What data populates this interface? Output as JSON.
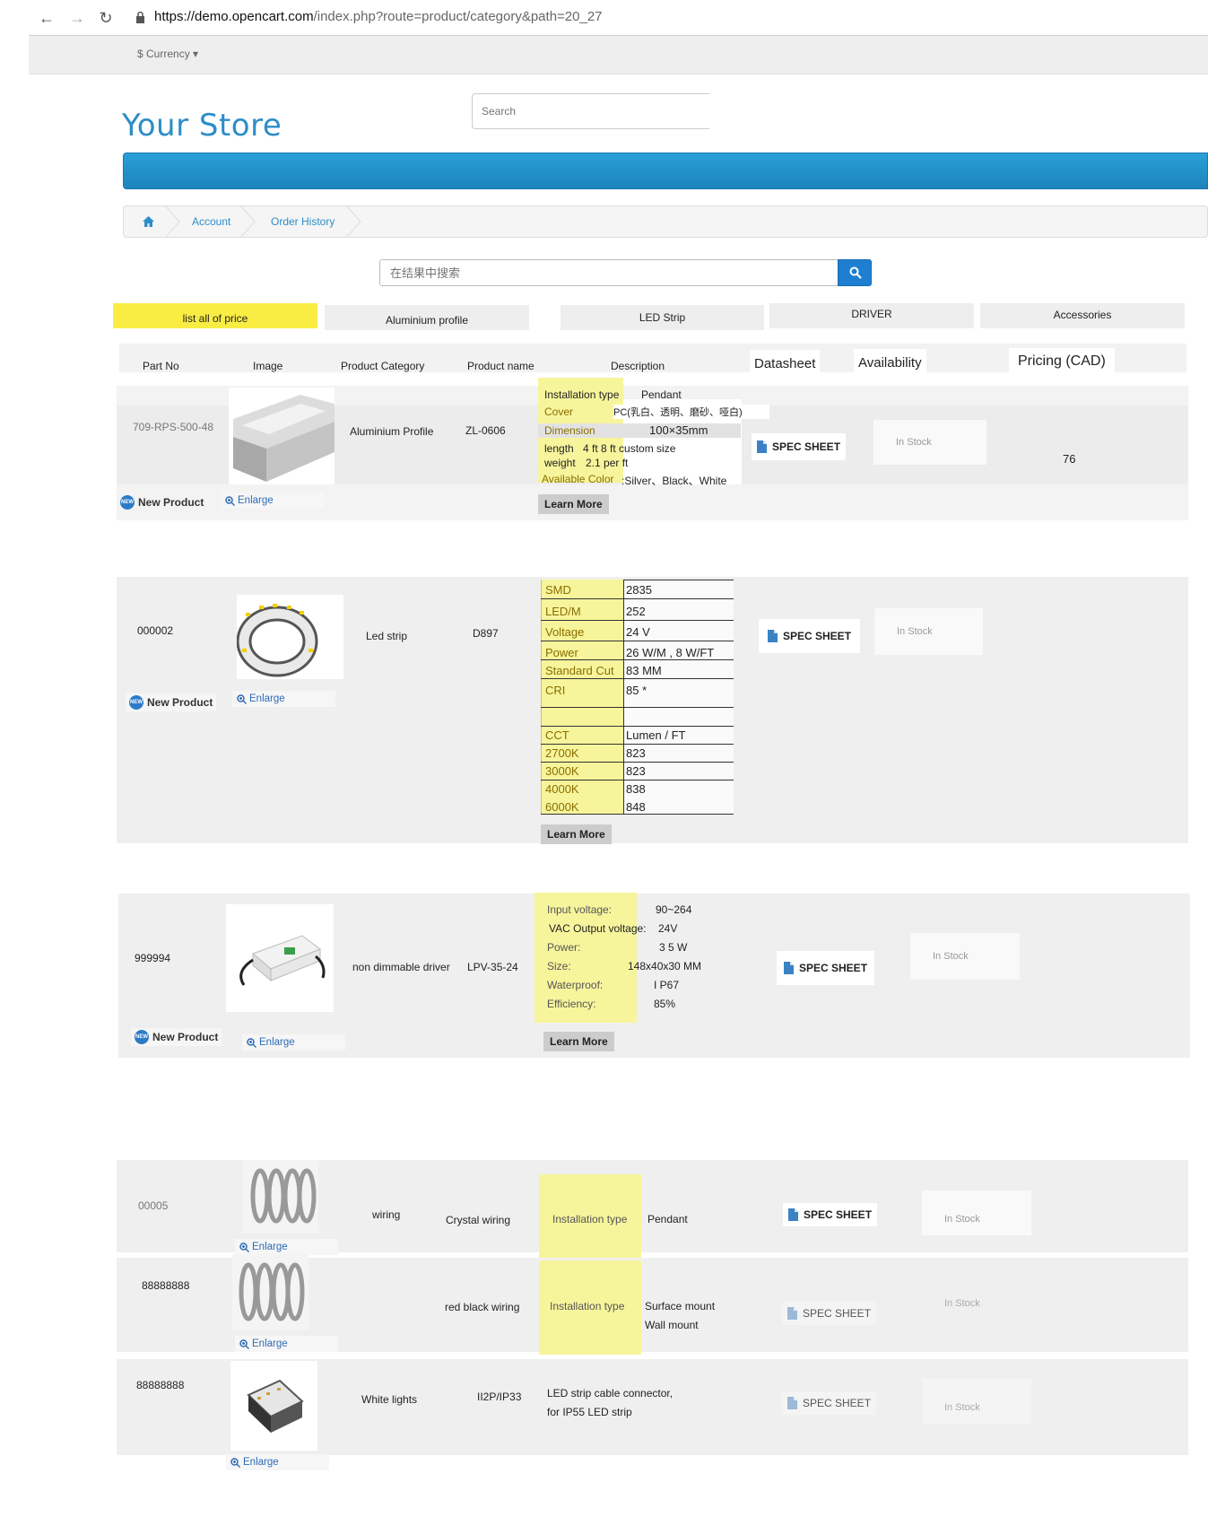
{
  "browser": {
    "url_host": "https://demo.opencart.com",
    "url_path": "/index.php?route=product/category&path=20_27"
  },
  "topbar": {
    "currency": "$ Currency"
  },
  "store": {
    "logo": "Your Store"
  },
  "search": {
    "placeholder": "Search"
  },
  "breadcrumb": {
    "items": [
      "Account",
      "Order History"
    ]
  },
  "filter_search": {
    "placeholder": "在结果中搜索"
  },
  "tabs": [
    "list  all of price",
    "Aluminium profile",
    "LED Strip",
    "DRIVER",
    "Accessories"
  ],
  "columns": {
    "part_no": "Part No",
    "image": "Image",
    "category": "Product Category",
    "name": "Product name",
    "description": "Description",
    "datasheet": "Datasheet",
    "availability": "Availability",
    "pricing": "Pricing (CAD)"
  },
  "common": {
    "new_product": "New Product",
    "enlarge": "Enlarge",
    "learn_more": "Learn More",
    "spec_sheet": "SPEC SHEET",
    "in_stock": "In Stock"
  },
  "rows": [
    {
      "part_no": "709-RPS-500-48",
      "category": "Aluminium Profile",
      "name": "ZL-0606",
      "price": "76",
      "desc": [
        {
          "label": "Installation type",
          "value": "Pendant"
        },
        {
          "label": "Cover",
          "value": "PC(乳白、透明、磨砂、哑白)"
        },
        {
          "label": "Dimension",
          "value": "100×35mm"
        },
        {
          "label": "length",
          "value": "4 ft   8 ft     custom size"
        },
        {
          "label": "weight",
          "value": "2.1 per ft"
        },
        {
          "label": "Available Color",
          "value": ":Silver、Black、White"
        }
      ]
    },
    {
      "part_no": "000002",
      "category": "Led strip",
      "name": "D897",
      "spec_table": [
        {
          "label": "SMD",
          "value": "2835"
        },
        {
          "label": "LED/M",
          "value": "252"
        },
        {
          "label": "Voltage",
          "value": "24 V"
        },
        {
          "label": "Power",
          "value": "26 W/M , 8 W/FT"
        },
        {
          "label": "Standard Cut",
          "value": "83 MM"
        },
        {
          "label": "CRI",
          "value": "85 *"
        }
      ],
      "cct_table": [
        {
          "label": "CCT",
          "value": "Lumen / FT"
        },
        {
          "label": "2700K",
          "value": "823"
        },
        {
          "label": "3000K",
          "value": "823"
        },
        {
          "label": "4000K",
          "value": "838"
        },
        {
          "label": "6000K",
          "value": "848"
        }
      ]
    },
    {
      "part_no": "999994",
      "category": "non dimmable driver",
      "name": "LPV-35-24",
      "desc": [
        {
          "label": "Input voltage:",
          "value": "90~264"
        },
        {
          "label": "VAC Output voltage:",
          "value": "24V"
        },
        {
          "label": "Power:",
          "value": "3 5 W"
        },
        {
          "label": "Size:",
          "value": "148x40x30 MM"
        },
        {
          "label": "Waterproof:",
          "value": "I P67"
        },
        {
          "label": "Efficiency:",
          "value": "85%"
        }
      ]
    },
    {
      "part_no": "00005",
      "category": "wiring",
      "name": "Crystal wiring",
      "install_label": "Installation type",
      "install_value": "Pendant"
    },
    {
      "part_no": "88888888",
      "category": "",
      "name": "red black wiring",
      "install_label": "Installation type",
      "install_value_1": "Surface mount",
      "install_value_2": "Wall mount"
    },
    {
      "part_no": "88888888",
      "category": "White lights",
      "name": "II2P/IP33",
      "desc_1": "LED strip cable connector,",
      "desc_2": "for IP55 LED strip"
    }
  ],
  "colors": {
    "accent": "#2d8dc8",
    "highlight": "#f7f59c",
    "tab_active": "#f9ed43",
    "menu": "#1e8cc8"
  }
}
